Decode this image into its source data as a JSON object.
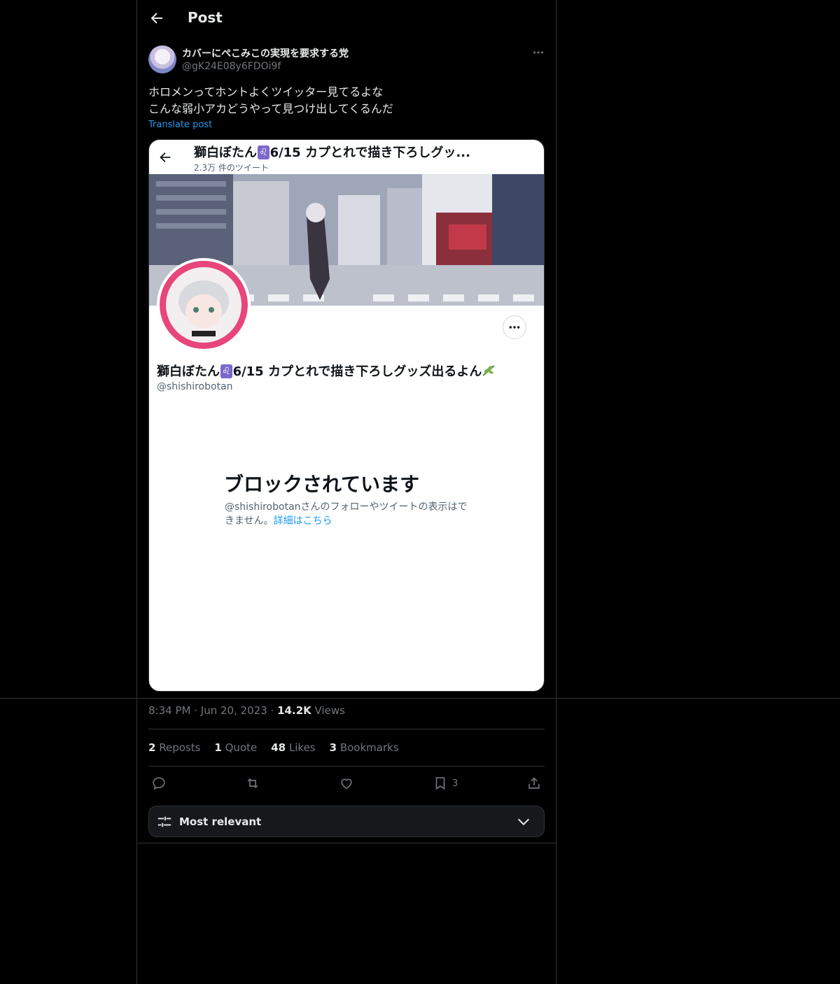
{
  "header": {
    "title": "Post"
  },
  "post": {
    "author_name": "カバーにぺこみこの実現を要求する党",
    "author_handle": "@gK24E08y6FDOi9f",
    "text": "ホロメンってホントよくツイッター見てるよな\nこんな弱小アカどうやって見つけ出してくるんだ",
    "translate_label": "Translate post",
    "time": "8:34 PM",
    "date": "Jun 20, 2023",
    "views_count": "14.2K",
    "views_label": "Views"
  },
  "embedded": {
    "title_a": "獅白ぼたん",
    "title_b": "6/15 カプとれで描き下ろしグッ...",
    "tweet_count": "2.3万 件のツイート",
    "name_a": "獅白ぼたん",
    "name_b": "6/15 カプとれで描き下ろしグッズ出るよん",
    "leo_symbol": "♌",
    "handle": "@shishirobotan",
    "blocked_title": "ブロックされています",
    "blocked_desc": "@shishirobotanさんのフォローやツイートの表示はできません。",
    "blocked_link": "詳細はこちら"
  },
  "stats": {
    "reposts_count": "2",
    "reposts_label": "Reposts",
    "quotes_count": "1",
    "quotes_label": "Quote",
    "likes_count": "48",
    "likes_label": "Likes",
    "bookmarks_count": "3",
    "bookmarks_label": "Bookmarks"
  },
  "actions": {
    "bookmark_count": "3"
  },
  "sort": {
    "label": "Most relevant"
  },
  "icons": [
    "back-arrow-icon",
    "more-icon",
    "reply-icon",
    "repost-icon",
    "like-icon",
    "bookmark-icon",
    "share-icon",
    "sliders-icon",
    "chevron-down-icon"
  ],
  "colors": {
    "accent": "#1d9bf0",
    "background": "#000000",
    "muted": "#71767b"
  }
}
